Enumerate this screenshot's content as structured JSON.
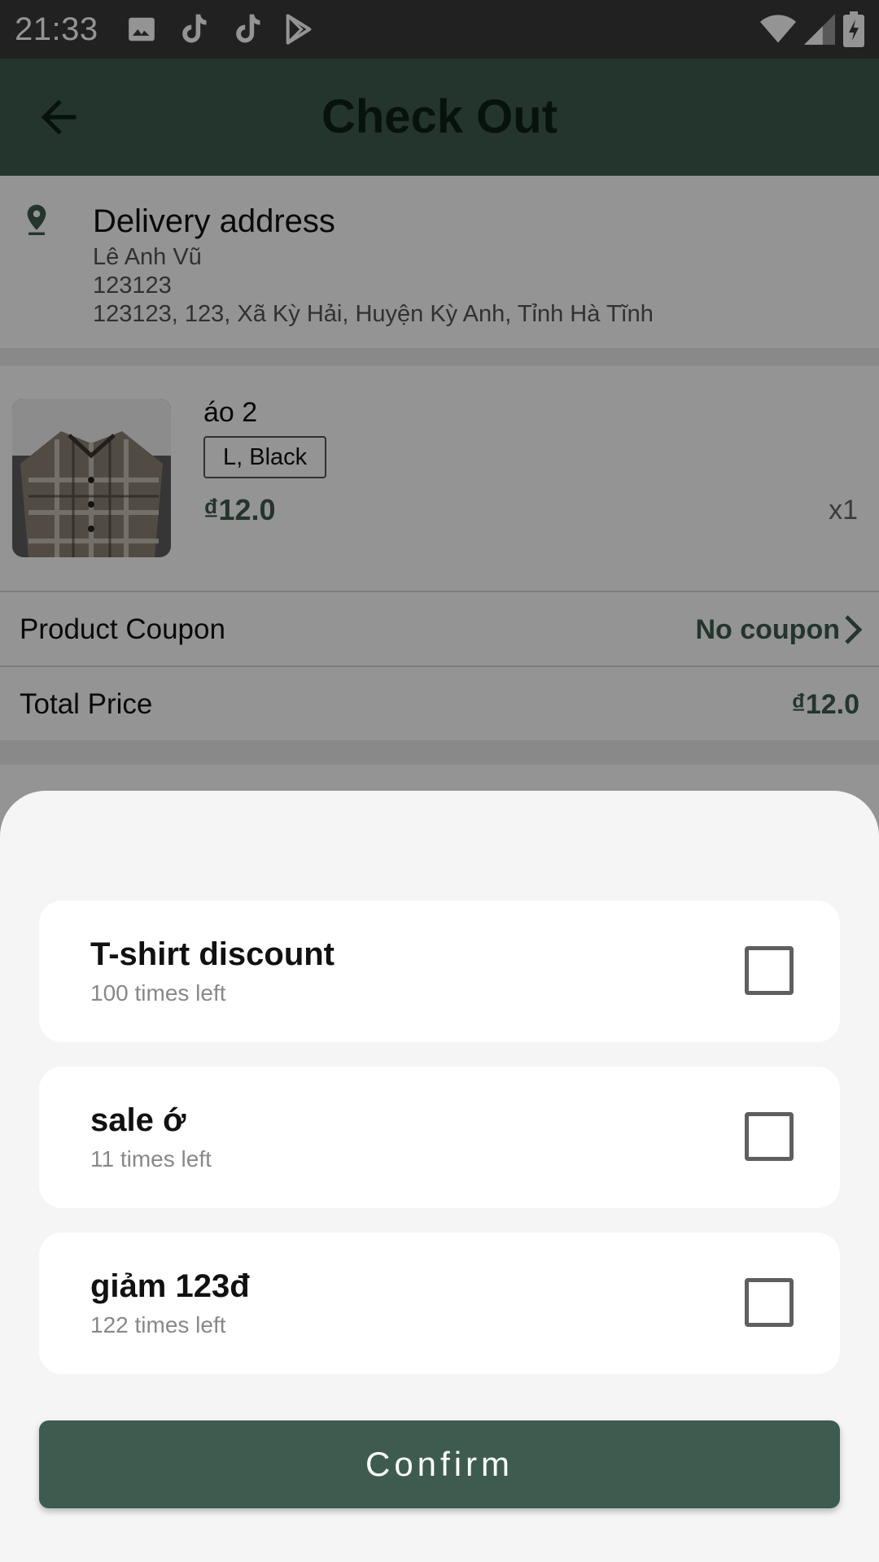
{
  "status_bar": {
    "time": "21:33",
    "icons": [
      "image-icon",
      "tiktok-icon",
      "tiktok-icon",
      "play-store-icon",
      "wifi-icon",
      "signal-icon",
      "battery-charging-icon"
    ]
  },
  "app_bar": {
    "title": "Check Out",
    "back_icon": "arrow-left-icon"
  },
  "delivery": {
    "title": "Delivery address",
    "name": "Lê Anh Vũ",
    "phone": "123123",
    "address": "123123, 123, Xã Kỳ Hải, Huyện Kỳ Anh, Tỉnh Hà Tĩnh"
  },
  "product": {
    "name": "áo 2",
    "variant": "L, Black",
    "price": "₫12.0",
    "quantity": "x1"
  },
  "coupon_row": {
    "label": "Product Coupon",
    "value": "No coupon"
  },
  "total_row": {
    "label": "Total Price",
    "value": "₫12.0"
  },
  "coupon_sheet": {
    "coupons": [
      {
        "name": "T-shirt discount",
        "uses_left": "100 times left",
        "checked": false
      },
      {
        "name": "sale ớ",
        "uses_left": "11 times left",
        "checked": false
      },
      {
        "name": "giảm 123đ",
        "uses_left": "122 times left",
        "checked": false
      }
    ],
    "confirm_label": "Confirm"
  },
  "colors": {
    "primary": "#3d5c4f",
    "status_bar": "#3a3a3a",
    "sheet_bg": "#f5f5f5"
  }
}
